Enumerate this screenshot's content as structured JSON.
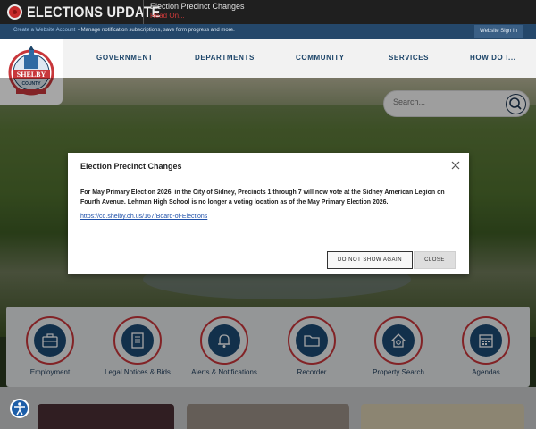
{
  "alert": {
    "title": "ELECTIONS UPDATE",
    "message": "Election Precinct Changes",
    "read_on": "Read On..."
  },
  "account_bar": {
    "create_link": "Create a Website Account",
    "description": "- Manage notification subscriptions, save form progress and more.",
    "sign_in": "Website Sign In"
  },
  "logo": {
    "line1": "SHELBY",
    "line2": "COUNTY"
  },
  "nav": {
    "items": [
      "GOVERNMENT",
      "DEPARTMENTS",
      "COMMUNITY",
      "SERVICES",
      "HOW DO I..."
    ]
  },
  "search": {
    "placeholder": "Search..."
  },
  "modal": {
    "title": "Election Precinct Changes",
    "body": "For May Primary Election 2026, in the City of Sidney, Precincts 1 through 7 will now vote at the Sidney American Legion on Fourth Avenue. Lehman High School is no longer a voting location as of the May Primary Election 2026.",
    "link": "https://co.shelby.oh.us/167/Board-of-Elections",
    "dont_show": "DO NOT SHOW AGAIN",
    "close": "CLOSE"
  },
  "quick_links": [
    {
      "label": "Employment",
      "icon": "briefcase-icon"
    },
    {
      "label": "Legal Notices & Bids",
      "icon": "document-icon"
    },
    {
      "label": "Alerts & Notifications",
      "icon": "bell-icon"
    },
    {
      "label": "Recorder",
      "icon": "folder-icon"
    },
    {
      "label": "Property Search",
      "icon": "house-search-icon"
    },
    {
      "label": "Agendas",
      "icon": "calendar-icon"
    }
  ],
  "colors": {
    "alert_red": "#c62a2a",
    "account_bar": "#24476a",
    "nav_text": "#1d4569",
    "icon_circle": "#1c4a74",
    "ring_red": "#c8373b"
  }
}
